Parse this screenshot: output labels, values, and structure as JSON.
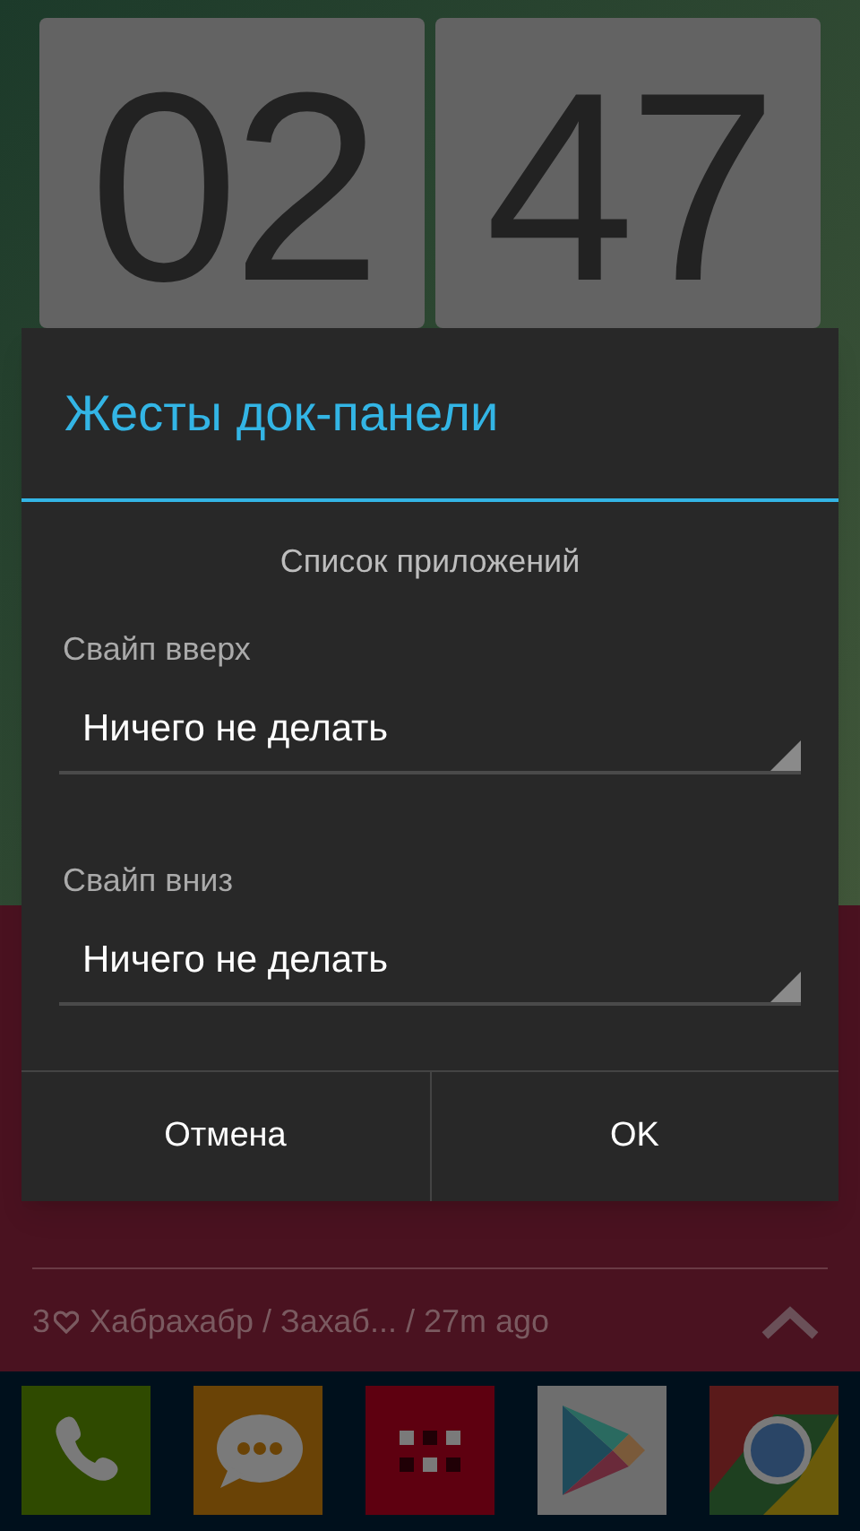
{
  "clock": {
    "hours": "02",
    "minutes": "47"
  },
  "dialog": {
    "title": "Жесты док-панели",
    "section": "Список приложений",
    "settings": [
      {
        "label": "Свайп вверх",
        "value": "Ничего не делать"
      },
      {
        "label": "Свайп вниз",
        "value": "Ничего не делать"
      }
    ],
    "buttons": [
      "Отмена",
      "OK"
    ]
  },
  "feed": {
    "likes": "3",
    "text": "Хабрахабр / Захаб... / 27m ago"
  },
  "dock": [
    {
      "kind": "phone"
    },
    {
      "kind": "messages"
    },
    {
      "kind": "apps"
    },
    {
      "kind": "store"
    },
    {
      "kind": "browser"
    }
  ]
}
